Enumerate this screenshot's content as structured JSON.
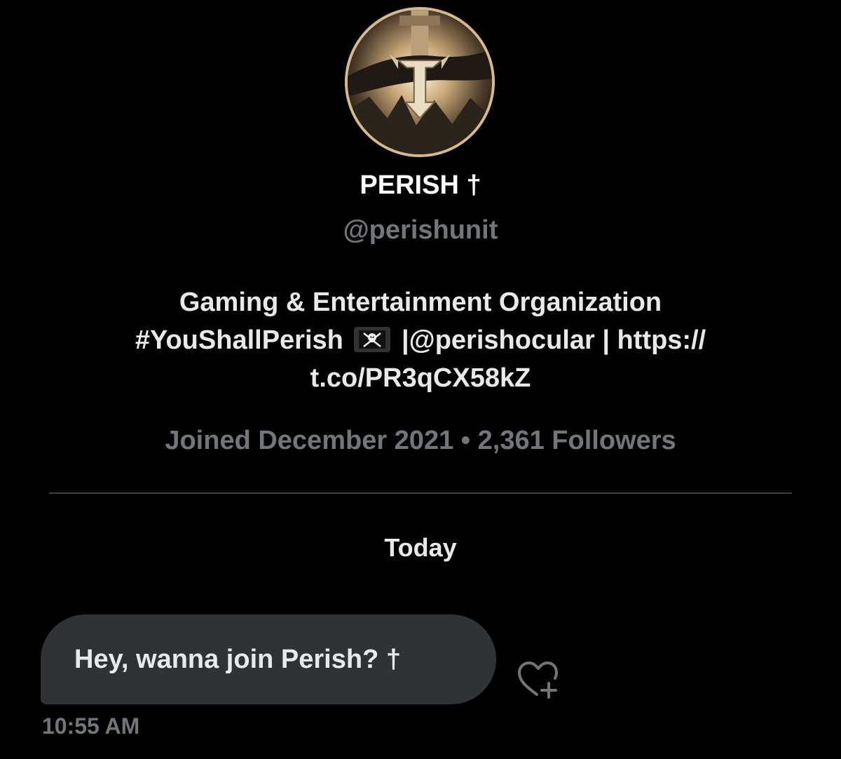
{
  "profile": {
    "display_name": "PERISH †",
    "handle": "@perishunit",
    "bio": {
      "line1": "Gaming & Entertainment Organization",
      "line2_hashtag": "#YouShallPerish",
      "line2_sep1": "|",
      "line2_mention": "@perishocular",
      "line2_sep2": "|",
      "line2_link_start": "https://",
      "line3_link_end": "t.co/PR3qCX58kZ",
      "emoji": "pirate-flag-icon"
    },
    "joined": "Joined December 2021",
    "meta_separator": "•",
    "followers": "2,361 Followers"
  },
  "conversation": {
    "day_label": "Today",
    "messages": [
      {
        "text": "Hey, wanna join Perish? †",
        "time": "10:55 AM"
      }
    ]
  },
  "icons": {
    "avatar": "perish-logo-avatar",
    "react": "heart-plus-icon"
  },
  "colors": {
    "background": "#000000",
    "primary_text": "#e7e9ea",
    "secondary_text": "#71767b",
    "bubble": "#2f3336",
    "avatar_ring": "#d8b98f"
  }
}
